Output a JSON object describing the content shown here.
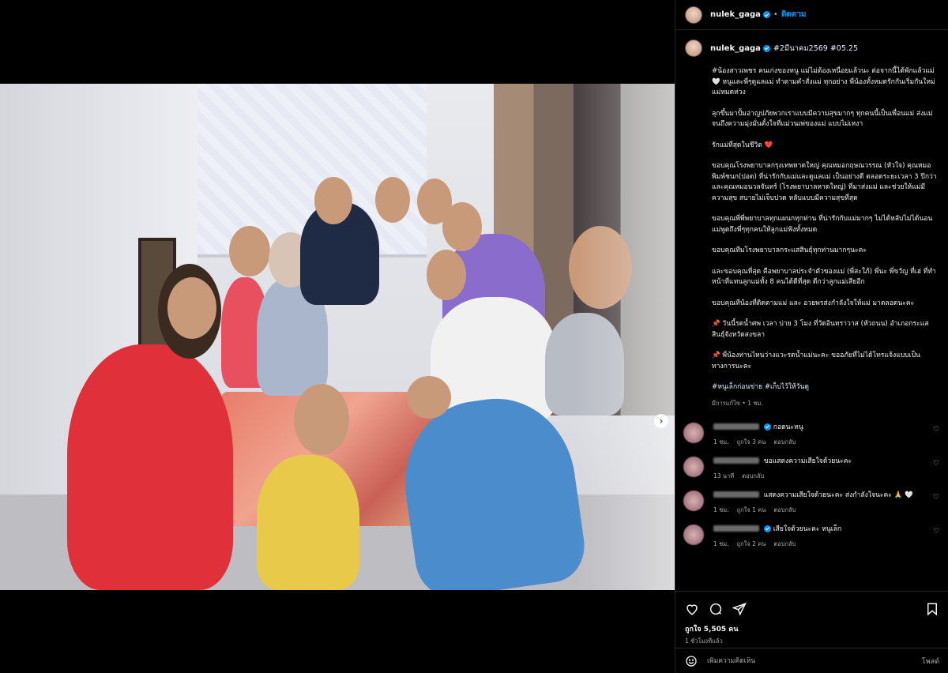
{
  "post": {
    "username": "nulek_gaga",
    "follow_label": "ติดตาม",
    "separator": "•",
    "date_tag": "#2มีนาคม2569 #05.25"
  },
  "caption": {
    "paragraphs": [
      "#น้องสาวเพชร คนเก่งของหนู แม่ไม่ต้องเหนื่อยแล้วนะ ต่อจากนี้ได้พักแล้วแม่ 🤍 หนูและพี่ๆดูแลแม่ ทำตามคำสั่งแม่ ทุกอย่าง พี่น้องทั้งหมดรักกันเริ่มกันใหม่ แม่หมดห่วง",
      "ลุกขึ้นมาปั้มอ่าญปภัยพวกเราแบบมีความสุขมากๆ ทุกคนนี้เป็นเพื่อนแม่ ส่งแม่จนถึงความมุ่งมั่นตั้งใจที่แม่วนเพ่ของแม่ แบบไม่เหงา",
      "รักแม่ที่สุดในชีวิต ❤️",
      "ขอบคุณโรงพยาบาลกรุงเทพหาดใหญ่ คุณหมอกฤษณวรรณ (หัวใจ) คุณหมอพิมพ์ชนก(ปอด) ที่น่ารักกับแม่และดูแลแม่ เป็นอย่างดี ตลอดระยะเวลา 3 ปีกว่า และคุณหมอนวลจันทร์ (โรงพยาบาลหาดใหญ่) ที่มาส่งแม่ และช่วยให้แม่มีความสุข สบายไม่เจ็บปวด หลับแบบมีความสุขที่สุด",
      "ขอบคุณพี่พี่พยาบาลทุกแผนกทุกท่าน ที่น่ารักกับแม่มากๆ ไม่ได้หลับไม่ได้นอน แม่พูดถึงพี่ๆทุกคนให้ลูกแม่ฟังทั้งหมด",
      "ขอบคุณทีมโรงพยาบาลกระแสสินธุ์ทุกท่านมากๆนะคะ",
      "และขอบคุณที่สุด คือพยาบาลประจำตัวของแม่ (พี่สะใภ้) พี่นะ พี่ขวัญ ที่เฮ่ ที่ทำหน้าที่แทนลูกแม่ทั้ง 8 คนได้ดีที่สุด ดีกว่าลูกแม่เสียอีก",
      "ขอบคุณทีน้องที่ติดตามแม่ และ อวยพรส่งกำลังใจให้แม่ มาตลอดนะคะ",
      "📌 วันนี้รดน้ำศพ เวลา บ่าย 3 โมง ที่วัดอินทราวาส (หัวถนน) อำเภอกระแสสินธุ์จังหวัดสงขลา",
      "📌 พี่น้องท่านไหนว่างแวะรดน้ำแม่นะคะ ขออภัยที่ไม่ได้โทรแจ้งแบบเป็นทางการนะคะ"
    ],
    "hashtags": "#หนูเล็กก่อนข่าย #เก็บไว้ให้วันดู",
    "edited_meta": "มีการแก้ไข • 1 ชม."
  },
  "comments": [
    {
      "text": "กอดนะหนู",
      "time": "1 ชม.",
      "likes": "ถูกใจ 3 คน",
      "reply": "ตอบกลับ"
    },
    {
      "text": "ขอแสดงความเสียใจด้วยนะคะ",
      "time": "13 นาที",
      "likes": "",
      "reply": "ตอบกลับ"
    },
    {
      "text": "แสดงความเสียใจด้วยนะคะ ส่งกำลังใจนะคะ 🙏 🤍",
      "time": "1 ชม.",
      "likes": "ถูกใจ 1 คน",
      "reply": "ตอบกลับ"
    },
    {
      "text": "เสียใจด้วยนะคะ หนูเล็ก",
      "time": "1 ชม.",
      "likes": "ถูกใจ 2 คน",
      "reply": "ตอบกลับ"
    }
  ],
  "actions": {
    "likes_label": "ถูกใจ 5,505 คน",
    "time_ago": "1 ชั่วโมงที่แล้ว"
  },
  "comment_box": {
    "placeholder": "เพิ่มความคิดเห็น",
    "post_label": "โพสต์"
  },
  "icons": {
    "heart": "heart-icon",
    "comment": "comment-icon",
    "share": "share-icon",
    "save": "bookmark-icon",
    "emoji": "emoji-icon",
    "next": "chevron-right-icon"
  },
  "colors": {
    "accent": "#0095f6",
    "panel_bg": "#000000",
    "muted": "#a8a8a8"
  }
}
